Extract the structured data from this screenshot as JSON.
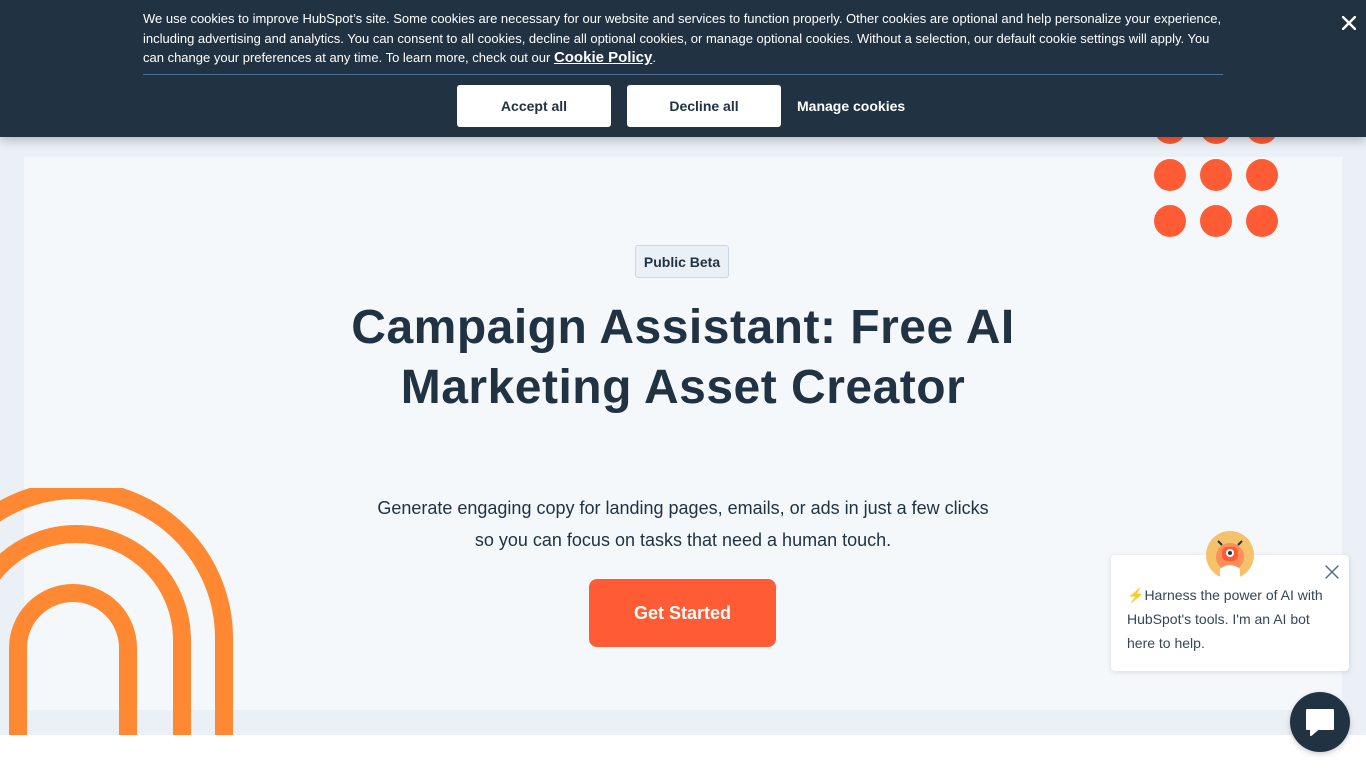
{
  "cookie_banner": {
    "text": "We use cookies to improve HubSpot’s site. Some cookies are necessary for our website and services to function properly. Other cookies are optional and help personalize your experience, including advertising and analytics. You can consent to all cookies, decline all optional cookies, or manage optional cookies. Without a selection, our default cookie settings will apply. You can change your preferences at any time. To learn more, check out our ",
    "policy_link": "Cookie Policy",
    "policy_suffix": ".",
    "accept_label": "Accept all",
    "decline_label": "Decline all",
    "manage_label": "Manage cookies",
    "close_icon": "close-icon"
  },
  "hero": {
    "badge": "Public Beta",
    "title": "Campaign Assistant: Free AI Marketing Asset Creator",
    "subtitle": "Generate engaging copy for landing pages, emails, or ads in just a few clicks so you can focus on tasks that need a human touch.",
    "cta_label": "Get Started"
  },
  "chat": {
    "emoji": "⚡",
    "message": "Harness the power of AI with HubSpot's tools. I'm an AI bot here to help.",
    "close_icon": "close-icon",
    "avatar_icon": "robot-avatar-icon",
    "launcher_icon": "chat-bubble-icon"
  },
  "colors": {
    "banner_bg": "#213343",
    "accent": "#ff5c35",
    "arch_orange": "#ff8933",
    "hero_bg": "#f5f8fa",
    "text_dark": "#213343"
  }
}
